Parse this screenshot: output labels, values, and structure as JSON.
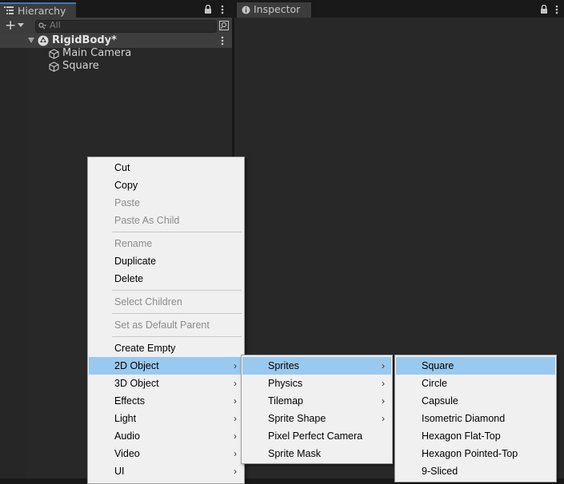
{
  "hierarchy": {
    "tab_label": "Hierarchy",
    "lock_icon": "lock-icon",
    "menu_icon": "kebab-menu-icon",
    "add_label": "+",
    "search_placeholder": "All",
    "scene": {
      "name": "RigidBody*"
    },
    "items": [
      {
        "label": "Main Camera"
      },
      {
        "label": "Square"
      }
    ]
  },
  "inspector": {
    "tab_label": "Inspector"
  },
  "context_menu": {
    "items": [
      {
        "label": "Cut"
      },
      {
        "label": "Copy"
      },
      {
        "label": "Paste"
      },
      {
        "label": "Paste As Child"
      },
      {
        "label": "Rename"
      },
      {
        "label": "Duplicate"
      },
      {
        "label": "Delete"
      },
      {
        "label": "Select Children"
      },
      {
        "label": "Set as Default Parent"
      },
      {
        "label": "Create Empty"
      },
      {
        "label": "2D Object"
      },
      {
        "label": "3D Object"
      },
      {
        "label": "Effects"
      },
      {
        "label": "Light"
      },
      {
        "label": "Audio"
      },
      {
        "label": "Video"
      },
      {
        "label": "UI"
      }
    ]
  },
  "submenu_2d": {
    "items": [
      {
        "label": "Sprites"
      },
      {
        "label": "Physics"
      },
      {
        "label": "Tilemap"
      },
      {
        "label": "Sprite Shape"
      },
      {
        "label": "Pixel Perfect Camera"
      },
      {
        "label": "Sprite Mask"
      }
    ]
  },
  "submenu_sprites": {
    "items": [
      {
        "label": "Square"
      },
      {
        "label": "Circle"
      },
      {
        "label": "Capsule"
      },
      {
        "label": "Isometric Diamond"
      },
      {
        "label": "Hexagon Flat-Top"
      },
      {
        "label": "Hexagon Pointed-Top"
      },
      {
        "label": "9-Sliced"
      }
    ]
  },
  "colors": {
    "accent": "#3a79bb",
    "selection": "#99c9ef",
    "panel": "#282828",
    "menu_bg": "#f0f0f0"
  }
}
